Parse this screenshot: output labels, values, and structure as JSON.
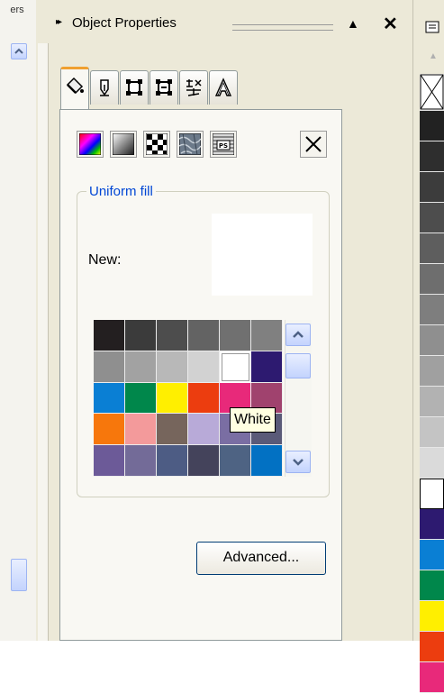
{
  "left_panel": {
    "label": "ers"
  },
  "docker": {
    "title": "Object Properties",
    "collapse_glyph": "▲",
    "close_glyph": "✕"
  },
  "tabs": [
    "fill-bucket-icon",
    "outline-pen-icon",
    "frame-icon",
    "anchor-frame-icon",
    "effects-icon",
    "character-icon"
  ],
  "fill_types": [
    "fountain-fill-icon",
    "linear-gradient-icon",
    "pattern-fill-icon",
    "texture-fill-icon",
    "postscript-fill-icon",
    "no-fill-icon"
  ],
  "uniform_fill": {
    "group_title": "Uniform fill",
    "new_label": "New:",
    "new_color": "#ffffff",
    "palette": [
      [
        "#231f20",
        "#3b3b3b",
        "#4d4d4d",
        "#636363",
        "#707070",
        "#808080"
      ],
      [
        "#8f8f8f",
        "#a2a2a2",
        "#b8b8b8",
        "#d2d2d2",
        "#ffffff",
        "#2d1a70"
      ],
      [
        "#0a7fd4",
        "#00874b",
        "#ffef00",
        "#ec3d0f",
        "#e8297a",
        "#a0426e"
      ],
      [
        "#f7770c",
        "#f39a9b",
        "#76655c",
        "#b8aad8",
        "#7a6ea3",
        "#5a5a78"
      ],
      [
        "#6c5a98",
        "#736b98",
        "#4d5c84",
        "#44435b",
        "#4e6383",
        "#0271c3"
      ]
    ],
    "selected_index": [
      1,
      4
    ],
    "tooltip": "White",
    "advanced_label": "Advanced..."
  },
  "right_palette": {
    "colors": [
      "#222222",
      "#2e2e2e",
      "#3c3c3c",
      "#4d4d4d",
      "#5e5e5e",
      "#6e6e6e",
      "#7e7e7e",
      "#8f8f8f",
      "#a0a0a0",
      "#b2b2b2",
      "#c4c4c4",
      "#dadada",
      "#ffffff",
      "#2d1a70",
      "#0a7fd4",
      "#00874b",
      "#ffef00",
      "#ec3d0f",
      "#e8297a"
    ]
  }
}
